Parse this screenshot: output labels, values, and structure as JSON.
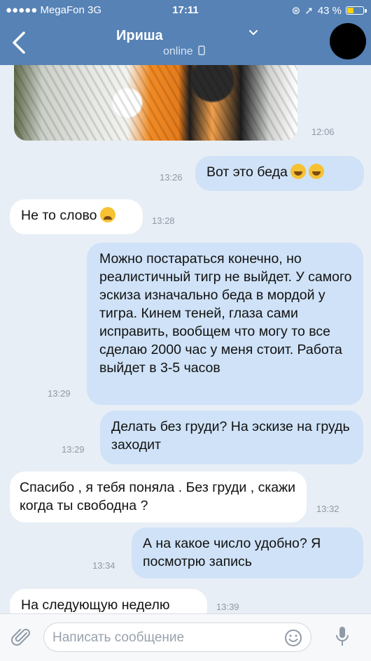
{
  "statusbar": {
    "carrier": "●●●●● MegaFon  3G",
    "time": "17:11",
    "battery": "43 %",
    "battery_level": 0.43
  },
  "header": {
    "name": "Ириша",
    "status": "online"
  },
  "photo_message": {
    "time": "12:06"
  },
  "messages": [
    {
      "dir": "out",
      "text": "Вот это беда",
      "time": "13:26"
    },
    {
      "dir": "in",
      "text": "Не то слово",
      "time": "13:28"
    },
    {
      "dir": "out",
      "text": "Можно постараться конечно, но реалистичный тигр не выйдет. У самого эскиза изначально беда в мордой у тигра. Кинем теней, глаза сами исправить, вообщем что могу то все сделаю 2000 час у меня стоит. Работа выйдет в 3-5 часов",
      "time": "13:29"
    },
    {
      "dir": "out",
      "text": "Делать без груди? На эскизе на грудь заходит",
      "time": "13:29"
    },
    {
      "dir": "in",
      "text": "Спасибо , я тебя поняла . Без груди , скажи когда ты свободна ?",
      "time": "13:32"
    },
    {
      "dir": "out",
      "text": "А на какое число удобно? Я посмотрю запись",
      "time": "13:34"
    },
    {
      "dir": "in",
      "text": "На следующую неделю",
      "time": "13:39"
    }
  ],
  "input": {
    "placeholder": "Написать сообщение"
  },
  "colors": {
    "header": "#5682b5",
    "outgoing": "#cfe2f7",
    "incoming": "#ffffff",
    "background": "#e8eef5"
  }
}
